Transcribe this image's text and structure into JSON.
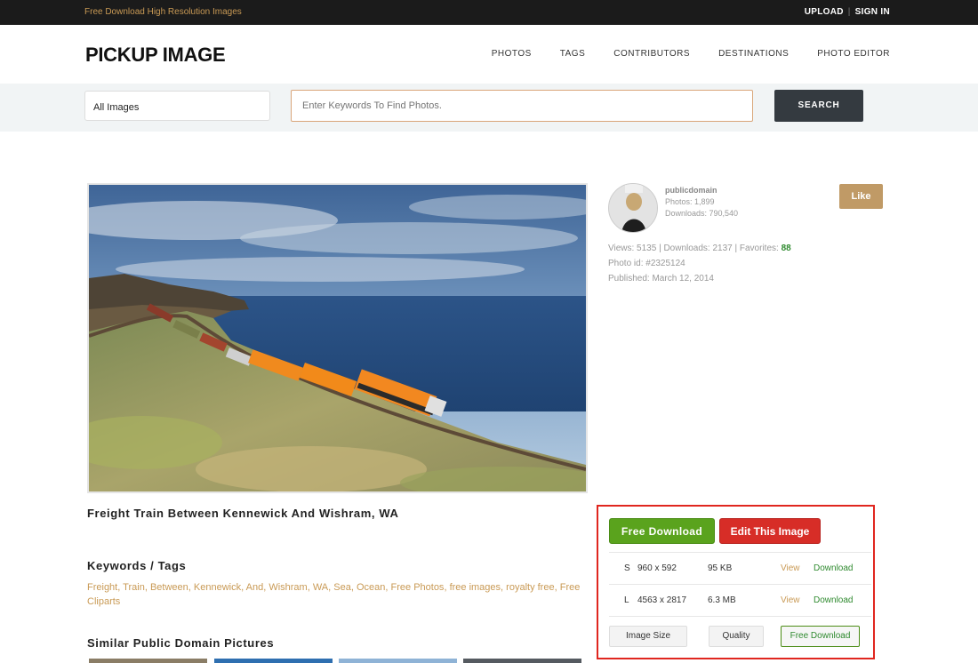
{
  "topbar": {
    "tagline": "Free Download High Resolution Images",
    "upload": "UPLOAD",
    "signin": "SIGN IN"
  },
  "header": {
    "logo": "PICKUP IMAGE",
    "nav": [
      "PHOTOS",
      "TAGS",
      "CONTRIBUTORS",
      "DESTINATIONS",
      "PHOTO EDITOR"
    ]
  },
  "search": {
    "category": "All Images",
    "placeholder": "Enter Keywords To Find Photos.",
    "button": "SEARCH"
  },
  "photo": {
    "title": "Freight Train Between Kennewick And Wishram, WA"
  },
  "author": {
    "name": "publicdomain",
    "photos": "Photos: 1,899",
    "downloads": "Downloads: 790,540",
    "like": "Like"
  },
  "stats": {
    "counts_text": "Views: 5135 | Downloads: 2137 | Favorites: ",
    "favorites": "88",
    "photo_id": "Photo id: #2325124",
    "published": "Published: March 12, 2014"
  },
  "keywords": {
    "heading": "Keywords / Tags",
    "tags": [
      "Freight",
      "Train",
      "Between",
      "Kennewick",
      "And",
      "Wishram",
      "WA",
      "Sea",
      "Ocean",
      "Free Photos",
      "free images",
      "royalty free",
      "Free Cliparts"
    ]
  },
  "similar": {
    "heading": "Similar Public Domain Pictures"
  },
  "download": {
    "free_button": "Free Download",
    "edit_button": "Edit This Image",
    "sizes": [
      {
        "code": "S",
        "dims": "960 x 592",
        "size": "95 KB",
        "view": "View",
        "download": "Download"
      },
      {
        "code": "L",
        "dims": "4563 x 2817",
        "size": "6.3 MB",
        "view": "View",
        "download": "Download"
      }
    ],
    "image_size": "Image Size",
    "quality": "Quality",
    "free_download": "Free Download"
  },
  "colors": {
    "accent": "#c99a55",
    "green": "#5aa31d",
    "red": "#d72d27",
    "dark": "#343a40"
  }
}
